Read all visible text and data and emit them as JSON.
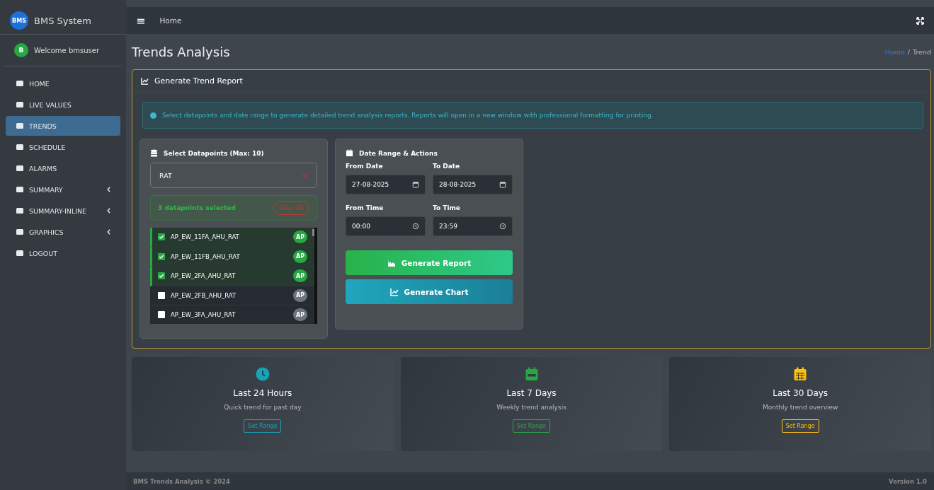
{
  "sidebar": {
    "brand_logo": "BMS",
    "brand": "BMS System",
    "user_avatar": "B",
    "user": "Welcome bmsuser",
    "items": [
      {
        "label": "HOME",
        "selected": false,
        "expandable": false
      },
      {
        "label": "LIVE VALUES",
        "selected": false,
        "expandable": false
      },
      {
        "label": "TRENDS",
        "selected": true,
        "expandable": false
      },
      {
        "label": "SCHEDULE",
        "selected": false,
        "expandable": false
      },
      {
        "label": "ALARMS",
        "selected": false,
        "expandable": false
      },
      {
        "label": "SUMMARY",
        "selected": false,
        "expandable": true
      },
      {
        "label": "SUMMARY-INLINE",
        "selected": false,
        "expandable": true
      },
      {
        "label": "GRAPHICS",
        "selected": false,
        "expandable": true
      },
      {
        "label": "LOGOUT",
        "selected": false,
        "expandable": false
      }
    ]
  },
  "topbar": {
    "menu_glyph": "≡",
    "title": "Home"
  },
  "page": {
    "title": "Trends Analysis",
    "breadcrumb": [
      {
        "label": "Home",
        "link": true
      },
      {
        "label": "/",
        "link": false
      },
      {
        "label": "Trend",
        "link": false
      }
    ]
  },
  "report": {
    "title": "Generate Trend Report",
    "info": "Select datapoints and date range to generate detailed trend analysis reports. Reports will open in a new window with professional formatting for printing.",
    "datapoints": {
      "title": "Select Datapoints (Max: 10)",
      "search": "RAT",
      "clear_glyph": "×",
      "selected_text": "3 datapoints selected",
      "clear_all": "Clear All",
      "items": [
        {
          "name": "AP_EW_11FA_AHU_RAT",
          "badge": "AP",
          "checked": true
        },
        {
          "name": "AP_EW_11FB_AHU_RAT",
          "badge": "AP",
          "checked": true
        },
        {
          "name": "AP_EW_2FA_AHU_RAT",
          "badge": "AP",
          "checked": true
        },
        {
          "name": "AP_EW_2FB_AHU_RAT",
          "badge": "AP",
          "checked": false
        },
        {
          "name": "AP_EW_3FA_AHU_RAT",
          "badge": "AP",
          "checked": false
        }
      ]
    },
    "dates": {
      "title": "Date Range & Actions",
      "fields": [
        {
          "label": "From Date",
          "value": "27-08-2025",
          "kind": "date"
        },
        {
          "label": "To Date",
          "value": "28-08-2025",
          "kind": "date"
        },
        {
          "label": "From Time",
          "value": "00:00",
          "kind": "time"
        },
        {
          "label": "To Time",
          "value": "23:59",
          "kind": "time"
        }
      ],
      "buttons": [
        {
          "label": "Generate Report",
          "kind": "report"
        },
        {
          "label": "Generate Chart",
          "kind": "chart"
        }
      ]
    }
  },
  "quick_ranges": [
    {
      "title": "Last 24 Hours",
      "subtitle": "Quick trend for past day",
      "button": "Set Range",
      "color": "#17a2b8",
      "kind": "clock"
    },
    {
      "title": "Last 7 Days",
      "subtitle": "Weekly trend analysis",
      "button": "Set Range",
      "color": "#28a745",
      "kind": "week"
    },
    {
      "title": "Last 30 Days",
      "subtitle": "Monthly trend overview",
      "button": "Set Range",
      "color": "#ffc107",
      "kind": "month"
    }
  ],
  "footer": {
    "left": "BMS Trends Analysis © 2024",
    "right": "Version 1.0"
  }
}
